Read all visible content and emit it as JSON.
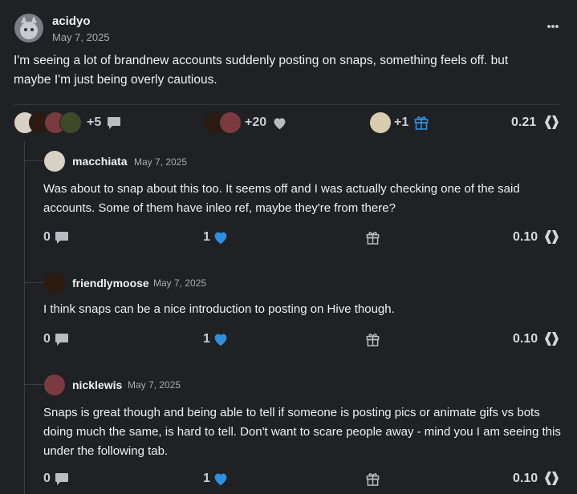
{
  "post": {
    "author": "acidyo",
    "date": "May 7, 2025",
    "text": "I'm seeing a lot of brandnew accounts suddenly posting on snaps, something feels off. but maybe I'm just being overly cautious.",
    "comments_extra": "+5",
    "votes_extra": "+20",
    "tips_extra": "+1",
    "payout": "0.21"
  },
  "replies": [
    {
      "author": "macchiata",
      "date": "May 7, 2025",
      "text": "Was about to snap about this too. It seems off and I was actually checking one of the said accounts. Some of them have inleo ref, maybe they're from there?",
      "comments": "0",
      "votes": "1",
      "payout": "0.10"
    },
    {
      "author": "friendlymoose",
      "date": "May 7, 2025",
      "text": "I think snaps can be a nice introduction to posting on Hive though.",
      "comments": "0",
      "votes": "1",
      "payout": "0.10"
    },
    {
      "author": "nicklewis",
      "date": "May 7, 2025",
      "text": "Snaps is great though and being able to tell if someone is posting pics or animate gifs vs bots doing much the same, is hard to tell. Don't want to scare people away - mind you I am seeing this under the following tab.",
      "comments": "0",
      "votes": "1",
      "payout": "0.10"
    }
  ],
  "icons": {
    "more": "more-horizontal-icon",
    "comment": "comment-icon",
    "heart": "heart-icon",
    "gift": "gift-icon",
    "hive": "hive-logo-icon"
  },
  "colors": {
    "background": "#1f2124",
    "heart_active": "#2f8fe0",
    "gift_active": "#2f8fe0"
  }
}
